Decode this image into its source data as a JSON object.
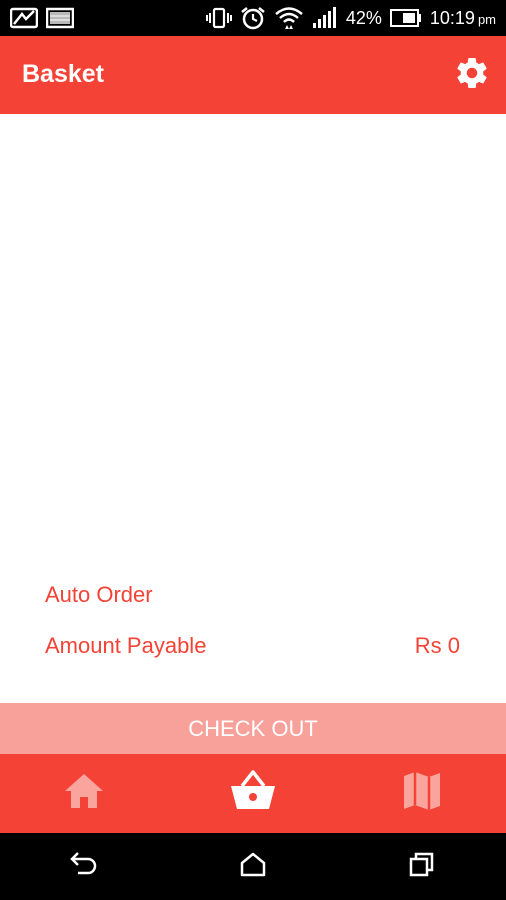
{
  "status_bar": {
    "battery": "42%",
    "time": "10:19",
    "ampm": "pm",
    "icons": [
      "image-icon",
      "image-icon",
      "vibrate-icon",
      "alarm-icon",
      "wifi-icon",
      "signal-icon",
      "battery-icon"
    ]
  },
  "app_bar": {
    "title": "Basket",
    "settings_icon": "gear-icon"
  },
  "basket": {
    "auto_order_label": "Auto Order",
    "amount_payable_label": "Amount Payable",
    "amount_payable_value": "Rs 0"
  },
  "checkout": {
    "label": "CHECK OUT"
  },
  "bottom_nav": {
    "tabs": [
      {
        "icon": "home-icon",
        "active": false
      },
      {
        "icon": "basket-icon",
        "active": true
      },
      {
        "icon": "map-icon",
        "active": false
      }
    ]
  },
  "system_nav": {
    "buttons": [
      "back-icon",
      "home-icon",
      "recents-icon"
    ]
  },
  "colors": {
    "primary": "#f44336",
    "checkout_bg": "#f7a19a",
    "inactive_icon": "#f9a59e"
  }
}
